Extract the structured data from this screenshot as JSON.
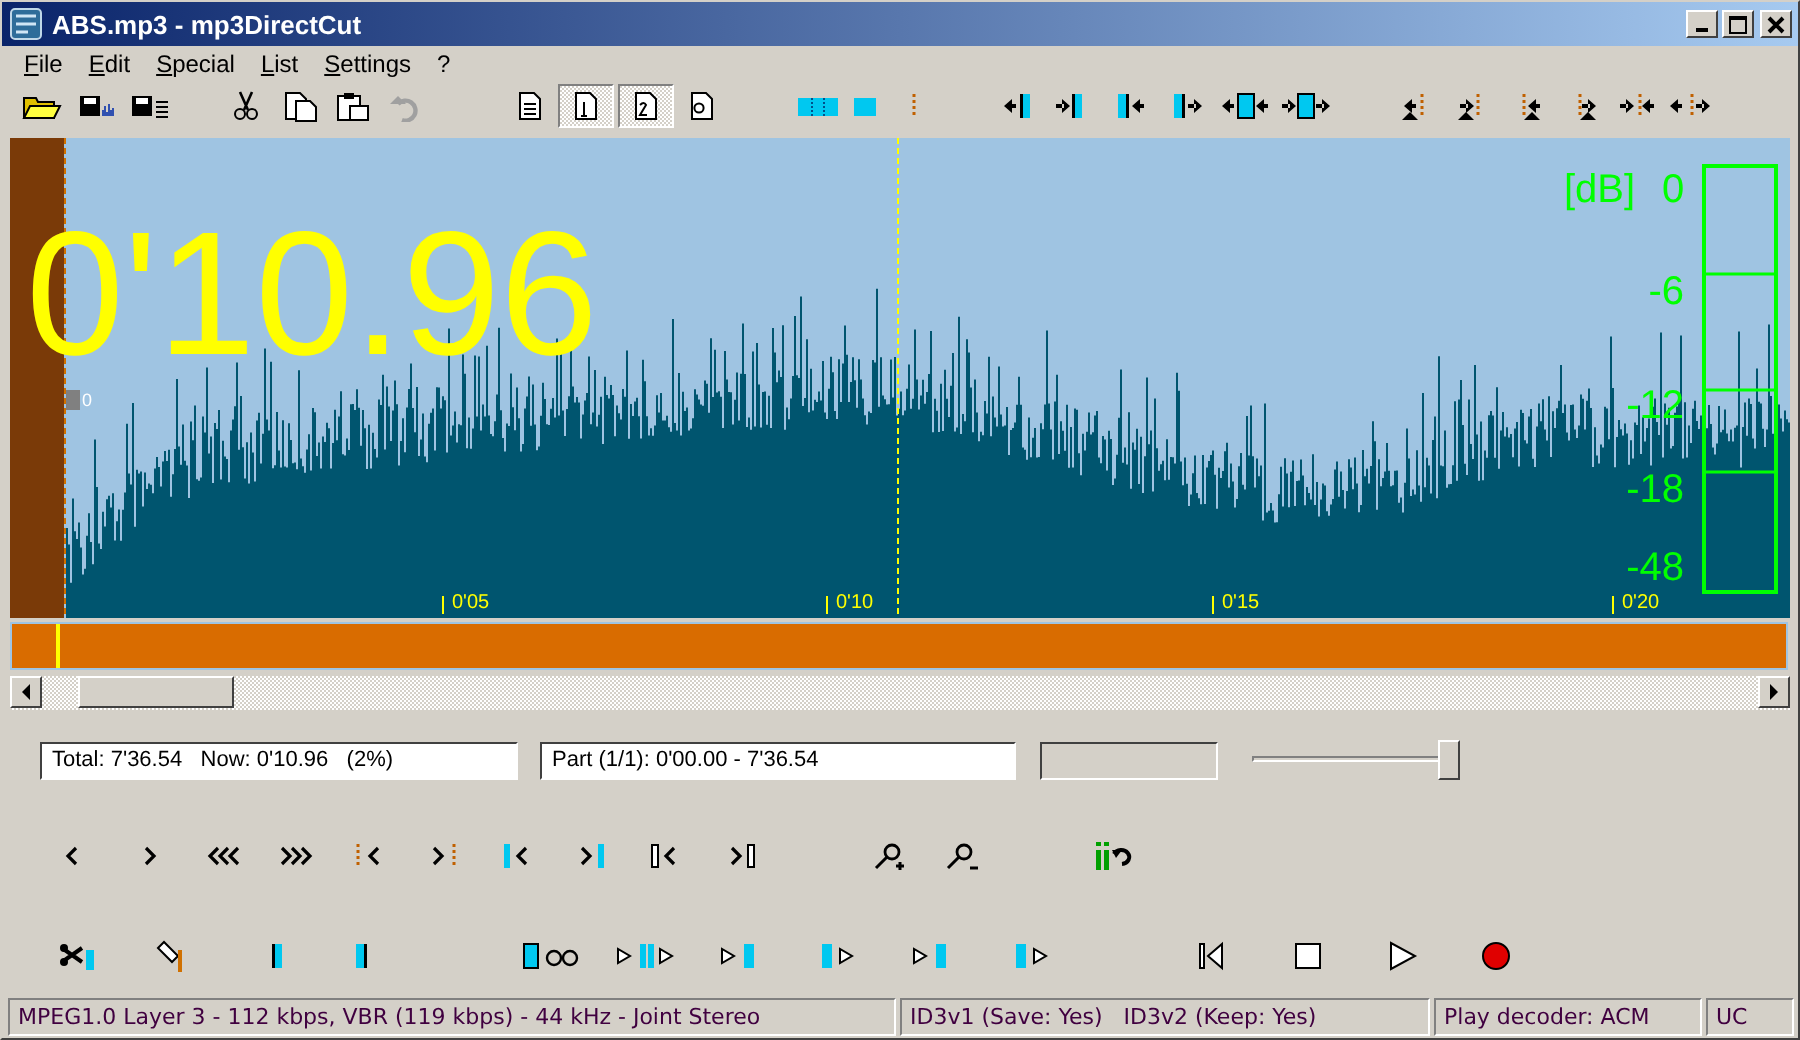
{
  "window": {
    "title": "ABS.mp3 - mp3DirectCut"
  },
  "menu": [
    "File",
    "Edit",
    "Special",
    "List",
    "Settings",
    "?"
  ],
  "toolbar": {
    "view_buttons": [
      {
        "pressed": false
      },
      {
        "pressed": true
      },
      {
        "pressed": true
      },
      {
        "pressed": false
      }
    ]
  },
  "waveform": {
    "position": "0'10.96",
    "cursor_marker": "0",
    "db_scale": [
      "[dB]",
      "0",
      "-6",
      "-12",
      "-18",
      "-48"
    ],
    "time_ticks": [
      "0'05",
      "0'10",
      "0'15",
      "0'20"
    ]
  },
  "overview": {
    "level": 0.025
  },
  "info": {
    "total": "Total: 7'36.54   Now: 0'10.96   (2%)",
    "part": "Part (1/1): 0'00.00 - 7'36.54",
    "volume": {
      "level": 1
    }
  },
  "status_bar": [
    "MPEG1.0 Layer 3 - 112 kbps, VBR (119 kbps) - 44 kHz - Joint Stereo",
    "ID3v1 (Save: Yes)   ID3v2 (Keep: Yes)",
    "Play decoder: ACM",
    "UC"
  ]
}
